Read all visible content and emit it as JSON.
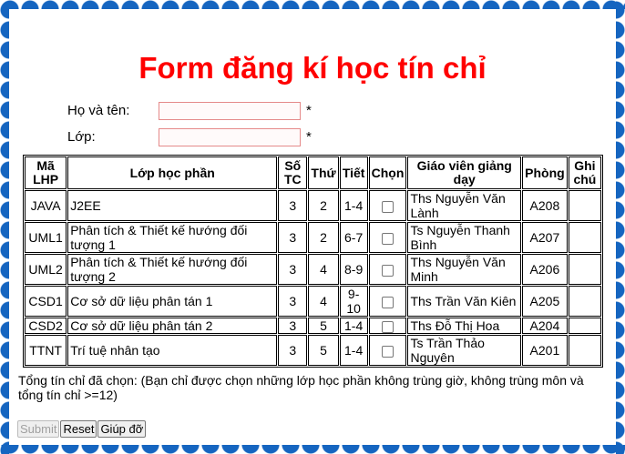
{
  "title": "Form đăng kí học tín chỉ",
  "form": {
    "name_label": "Họ và tên:",
    "class_label": "Lớp:",
    "required_mark": "*",
    "name_value": "",
    "class_value": ""
  },
  "table": {
    "headers": [
      "Mã LHP",
      "Lớp học phần",
      "Số TC",
      "Thứ",
      "Tiết",
      "Chọn",
      "Giáo viên giảng dạy",
      "Phòng",
      "Ghi chú"
    ],
    "rows": [
      {
        "code": "JAVA",
        "name": "J2EE",
        "credits": "3",
        "day": "2",
        "period": "1-4",
        "teacher": "Ths Nguyễn Văn Lành",
        "room": "A208",
        "note": ""
      },
      {
        "code": "UML1",
        "name": "Phân tích & Thiết kế hướng đối tượng 1",
        "credits": "3",
        "day": "2",
        "period": "6-7",
        "teacher": "Ts Nguyễn Thanh Bình",
        "room": "A207",
        "note": ""
      },
      {
        "code": "UML2",
        "name": "Phân tích & Thiết kế hướng đối tượng 2",
        "credits": "3",
        "day": "4",
        "period": "8-9",
        "teacher": "Ths Nguyễn Văn Minh",
        "room": "A206",
        "note": ""
      },
      {
        "code": "CSD1",
        "name": "Cơ sở dữ liệu phân tán 1",
        "credits": "3",
        "day": "4",
        "period": "9-10",
        "teacher": "Ths Trần Văn Kiên",
        "room": "A205",
        "note": ""
      },
      {
        "code": "CSD2",
        "name": "Cơ sở dữ liệu phân tán 2",
        "credits": "3",
        "day": "5",
        "period": "1-4",
        "teacher": "Ths Đỗ Thị Hoa",
        "room": "A204",
        "note": ""
      },
      {
        "code": "TTNT",
        "name": "Trí tuệ nhân tạo",
        "credits": "3",
        "day": "5",
        "period": "1-4",
        "teacher": "Ts Trần Thảo Nguyên",
        "room": "A201",
        "note": ""
      }
    ]
  },
  "summary": "Tổng tín chỉ đã chọn:  (Bạn chỉ được chọn những lớp học phần không trùng giờ, không trùng môn và tổng tín chỉ >=12)",
  "buttons": {
    "submit": "Submit",
    "reset": "Reset",
    "help": "Giúp đỡ"
  }
}
